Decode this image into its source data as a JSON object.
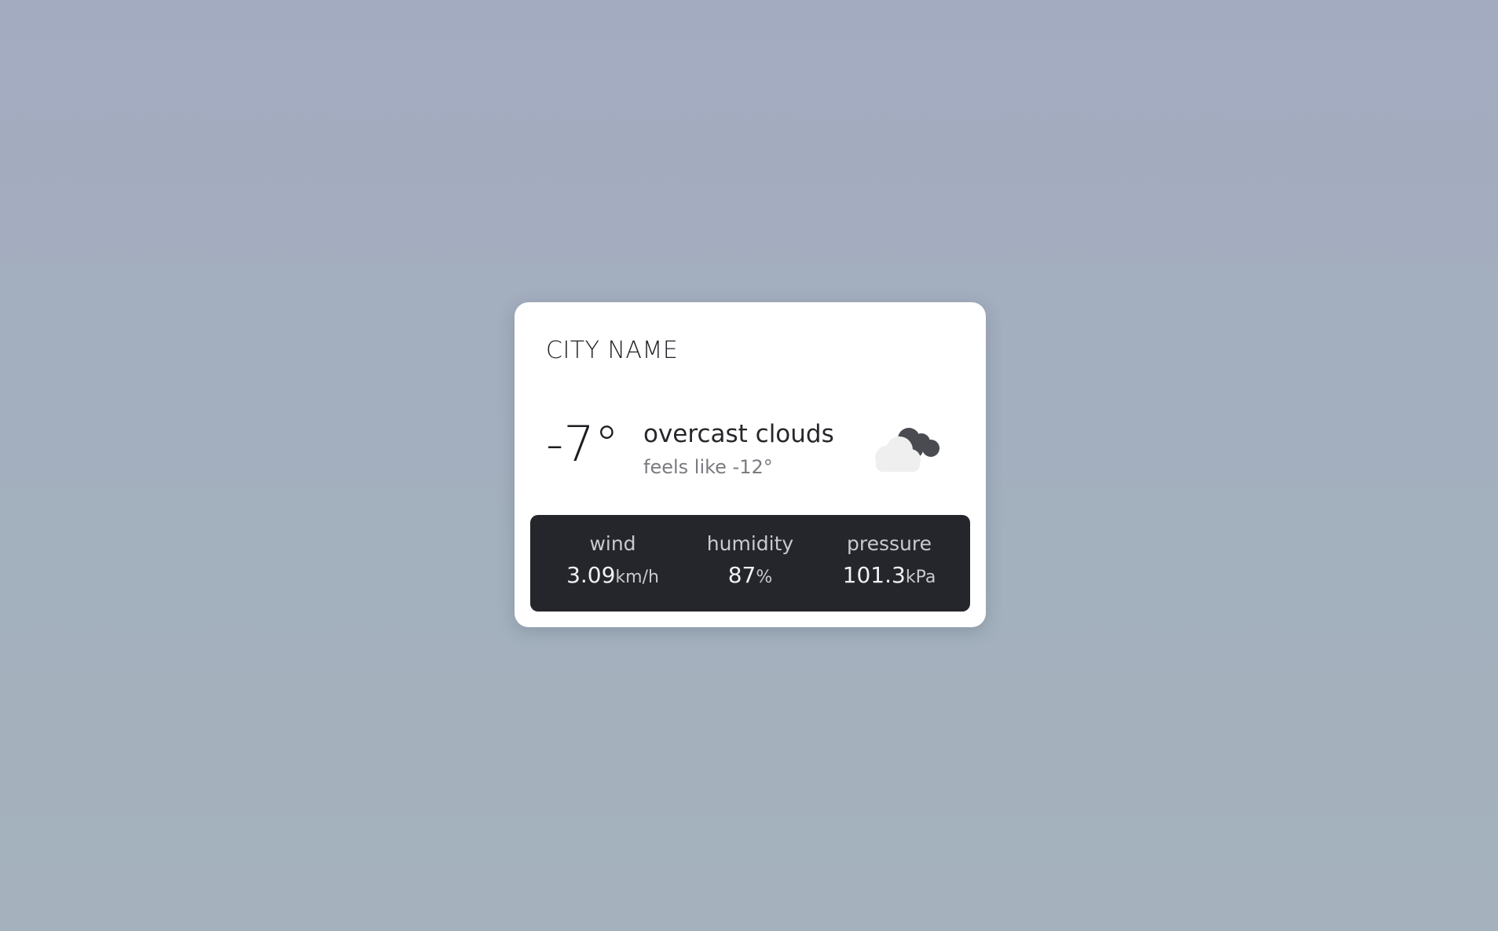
{
  "city": "CITY NAME",
  "current": {
    "temperature": "-7°",
    "condition": "overcast clouds",
    "feels_like": "feels like -12°",
    "icon": "overcast-clouds-icon"
  },
  "stats": {
    "wind": {
      "label": "wind",
      "value": "3.09",
      "unit": "km/h"
    },
    "humidity": {
      "label": "humidity",
      "value": "87",
      "unit": "%"
    },
    "pressure": {
      "label": "pressure",
      "value": "101.3",
      "unit": "kPa"
    }
  },
  "colors": {
    "card_bg": "#ffffff",
    "stats_bg": "#25262b",
    "cloud_dark": "#4a4b50",
    "cloud_light": "#efefef"
  }
}
